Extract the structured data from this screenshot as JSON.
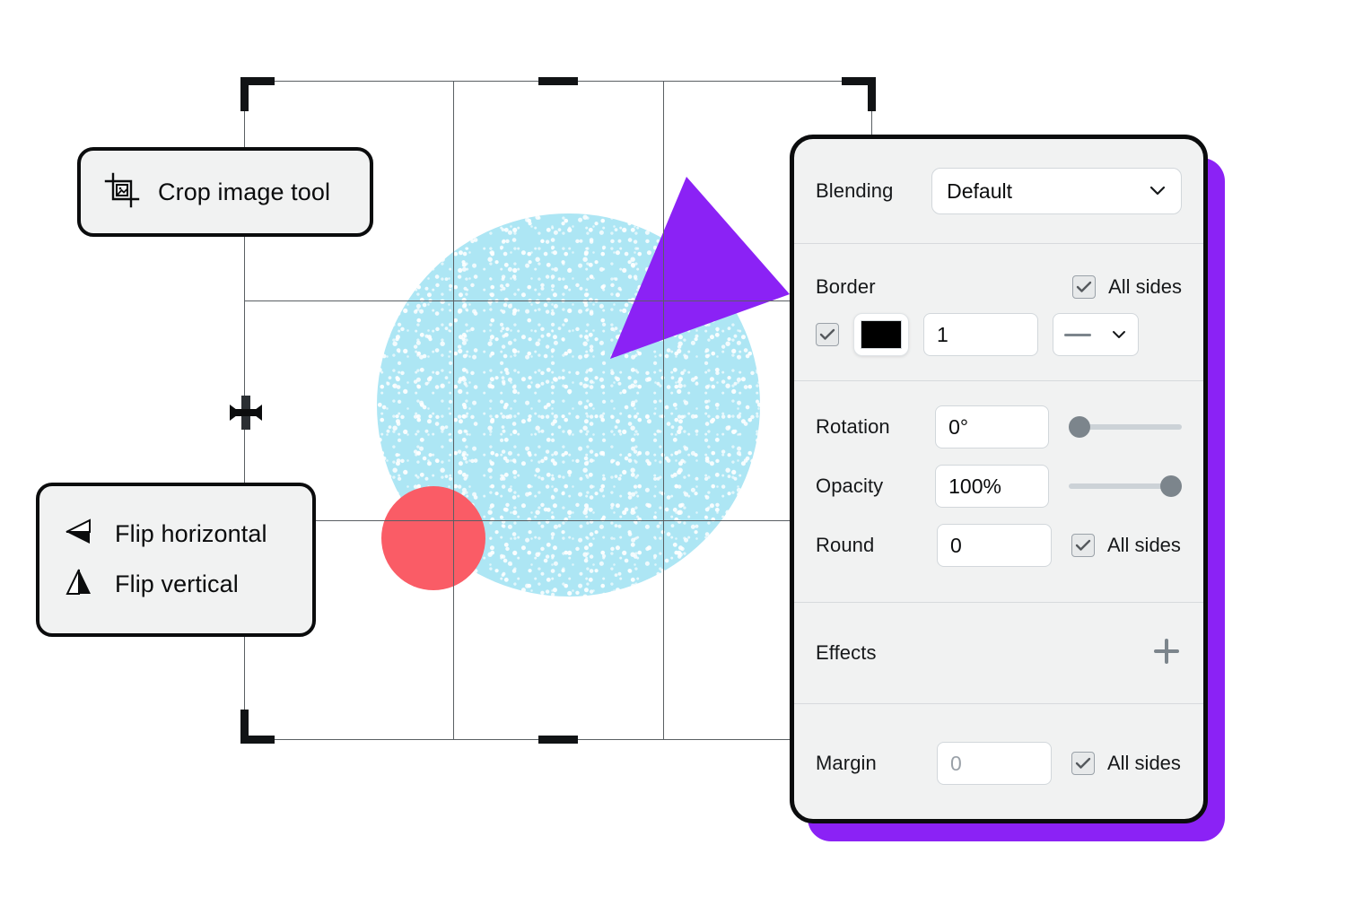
{
  "canvas": {
    "name": "image-editor-canvas",
    "crop_overlay": {
      "name": "crop-selection-frame",
      "grid_columns": 3,
      "grid_rows": 3,
      "handles": [
        "top-left",
        "top-center",
        "top-right",
        "middle-left",
        "bottom-left",
        "bottom-center",
        "bottom-right"
      ]
    },
    "shapes": [
      {
        "name": "cyan-textured-circle",
        "type": "circle",
        "color": "#ade6f4",
        "texture": "noise"
      },
      {
        "name": "purple-triangle",
        "type": "triangle",
        "color": "#8b22f5"
      },
      {
        "name": "red-circle",
        "type": "circle",
        "color": "#fa5c66"
      }
    ],
    "cursor": {
      "name": "move-resize-cursor",
      "icon": "arrows-horizontal-icon"
    }
  },
  "tooltips": {
    "crop": {
      "icon": "crop-image-icon",
      "label": "Crop image tool"
    },
    "flip": {
      "items": [
        {
          "icon": "flip-horizontal-icon",
          "label": "Flip horizontal"
        },
        {
          "icon": "flip-vertical-icon",
          "label": "Flip vertical"
        }
      ]
    }
  },
  "panel": {
    "accent_color": "#8b22f5",
    "blending": {
      "label": "Blending",
      "value": "Default",
      "chevron": "chevron-down-icon"
    },
    "border": {
      "label": "Border",
      "all_sides_label": "All sides",
      "all_sides_checked": true,
      "enabled_checked": true,
      "color": "#000000",
      "width": "1",
      "style": "solid",
      "style_glyph": "—",
      "chevron": "chevron-down-icon"
    },
    "rotation": {
      "label": "Rotation",
      "value": "0°",
      "slider_percent": 0
    },
    "opacity": {
      "label": "Opacity",
      "value": "100%",
      "slider_percent": 100
    },
    "round": {
      "label": "Round",
      "value": "0",
      "all_sides_label": "All sides",
      "all_sides_checked": true
    },
    "effects": {
      "label": "Effects",
      "add_icon": "plus-icon"
    },
    "margin": {
      "label": "Margin",
      "value": "0",
      "is_placeholder": true,
      "all_sides_label": "All sides",
      "all_sides_checked": true
    }
  }
}
